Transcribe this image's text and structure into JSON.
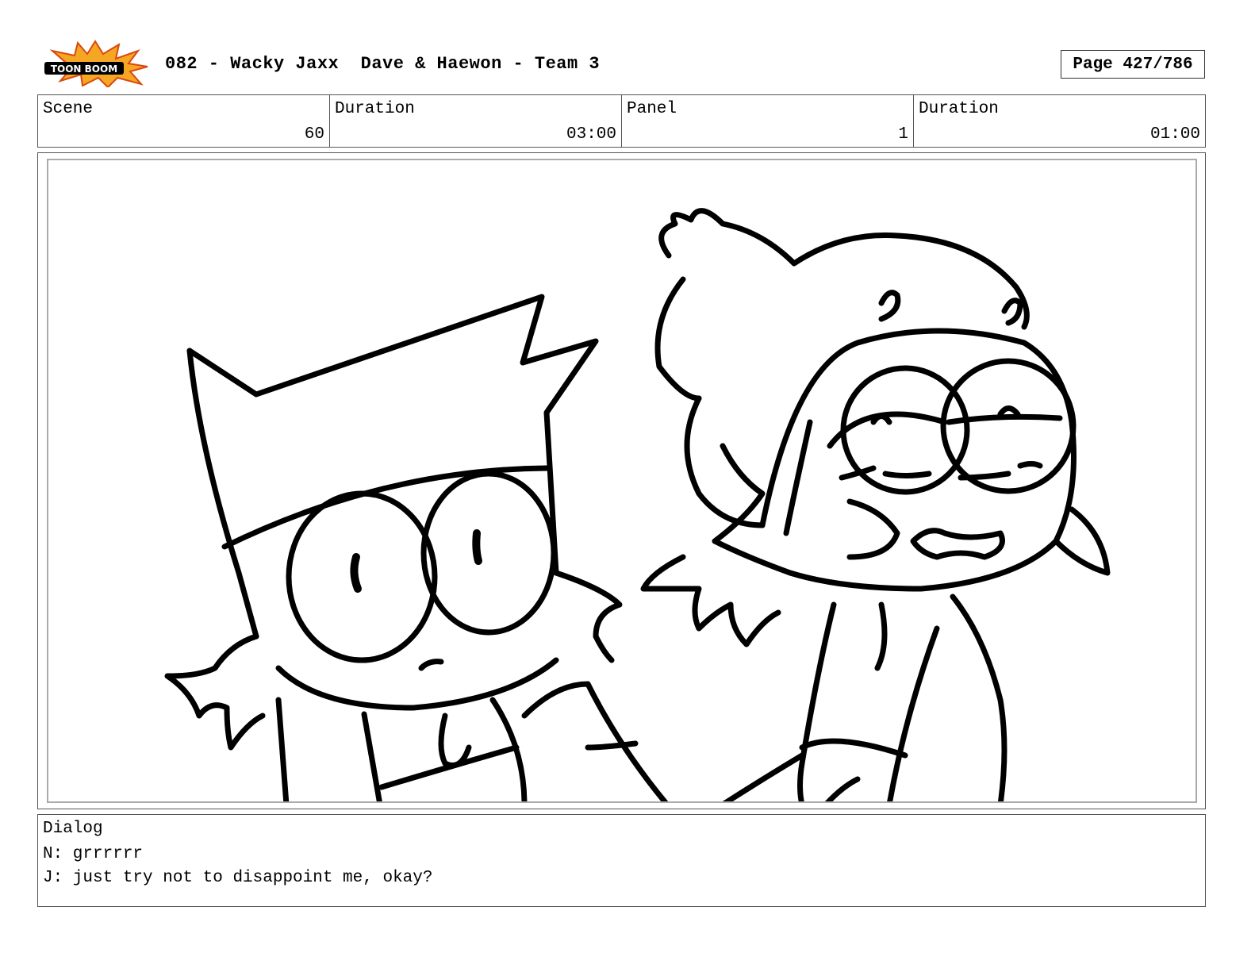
{
  "header": {
    "logo_text": "TOON BOOM",
    "title": "082 - Wacky Jaxx  Dave & Haewon - Team 3",
    "page": "Page 427/786"
  },
  "info": {
    "scene_label": "Scene",
    "scene_value": "60",
    "duration_label": "Duration",
    "duration_value": "03:00",
    "panel_label": "Panel",
    "panel_value": "1",
    "panel_duration_label": "Duration",
    "panel_duration_value": "01:00"
  },
  "dialog": {
    "label": "Dialog",
    "lines": [
      "N: grrrrrr",
      "J: just try not to disappoint me, okay?"
    ]
  }
}
